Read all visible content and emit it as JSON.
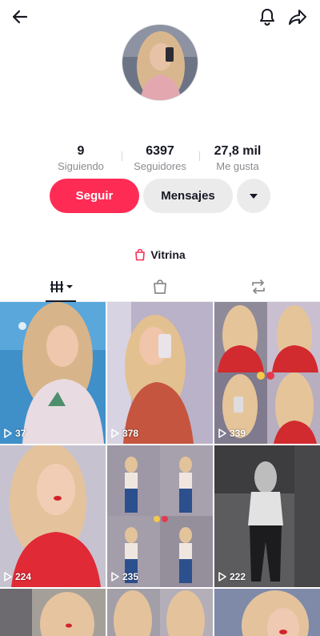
{
  "profile": {
    "stats": [
      {
        "value": "9",
        "label": "Siguiendo"
      },
      {
        "value": "6397",
        "label": "Seguidores"
      },
      {
        "value": "27,8 mil",
        "label": "Me gusta"
      }
    ]
  },
  "actions": {
    "follow_label": "Seguir",
    "message_label": "Mensajes"
  },
  "showcase": {
    "label": "Vitrina",
    "icon": "shopping-bag-icon",
    "color": "#fe2c55"
  },
  "tabs": [
    {
      "name": "videos-grid-icon",
      "active": true
    },
    {
      "name": "shop-bag-icon",
      "active": false
    },
    {
      "name": "repost-icon",
      "active": false
    }
  ],
  "videos": [
    {
      "views": "37"
    },
    {
      "views": "378"
    },
    {
      "views": "339"
    },
    {
      "views": "224"
    },
    {
      "views": "235"
    },
    {
      "views": "222"
    },
    {
      "views": ""
    },
    {
      "views": ""
    },
    {
      "views": ""
    }
  ],
  "colors": {
    "accent": "#fe2c55",
    "secondary_button": "#ebebec",
    "muted_text": "#8a8b91"
  }
}
